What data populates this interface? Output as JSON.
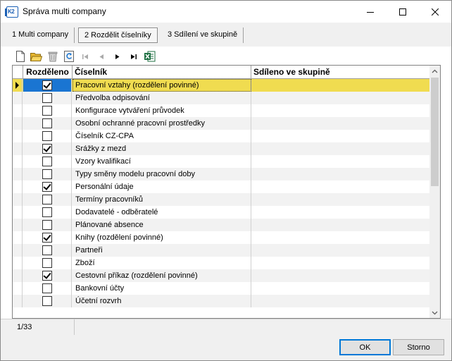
{
  "window": {
    "title": "Správa multi company",
    "icon_text": "K2"
  },
  "tabs": [
    {
      "label": "1 Multi company"
    },
    {
      "label": "2 Rozdělit číselníky"
    },
    {
      "label": "3 Sdílení ve skupině"
    }
  ],
  "grid": {
    "columns": {
      "shared_split": "Rozděleno",
      "codebook": "Číselník",
      "shared_group": "Sdíleno ve skupině"
    },
    "rows": [
      {
        "checked": true,
        "name": "Pracovní vztahy (rozdělení povinné)",
        "group": ""
      },
      {
        "checked": false,
        "name": "Předvolba odpisování",
        "group": ""
      },
      {
        "checked": false,
        "name": "Konfigurace vytváření průvodek",
        "group": ""
      },
      {
        "checked": false,
        "name": "Osobní ochranné pracovní prostředky",
        "group": ""
      },
      {
        "checked": false,
        "name": "Číselník CZ-CPA",
        "group": ""
      },
      {
        "checked": true,
        "name": "Srážky z mezd",
        "group": ""
      },
      {
        "checked": false,
        "name": "Vzory kvalifikací",
        "group": ""
      },
      {
        "checked": false,
        "name": "Typy směny modelu pracovní doby",
        "group": ""
      },
      {
        "checked": true,
        "name": "Personální údaje",
        "group": ""
      },
      {
        "checked": false,
        "name": "Termíny pracovníků",
        "group": ""
      },
      {
        "checked": false,
        "name": "Dodavatelé - odběratelé",
        "group": ""
      },
      {
        "checked": false,
        "name": "Plánované absence",
        "group": ""
      },
      {
        "checked": true,
        "name": "Knihy (rozdělení povinné)",
        "group": ""
      },
      {
        "checked": false,
        "name": "Partneři",
        "group": ""
      },
      {
        "checked": false,
        "name": "Zboží",
        "group": ""
      },
      {
        "checked": true,
        "name": "Cestovní příkaz (rozdělení povinné)",
        "group": ""
      },
      {
        "checked": false,
        "name": "Bankovní účty",
        "group": ""
      },
      {
        "checked": false,
        "name": "Účetní rozvrh",
        "group": ""
      }
    ]
  },
  "status": {
    "record_count": "1/33"
  },
  "buttons": {
    "ok": "OK",
    "cancel": "Storno"
  },
  "colors": {
    "selected_row": "#f0dc50",
    "selected_cell": "#1a75d2",
    "default_button_border": "#0078d7"
  }
}
